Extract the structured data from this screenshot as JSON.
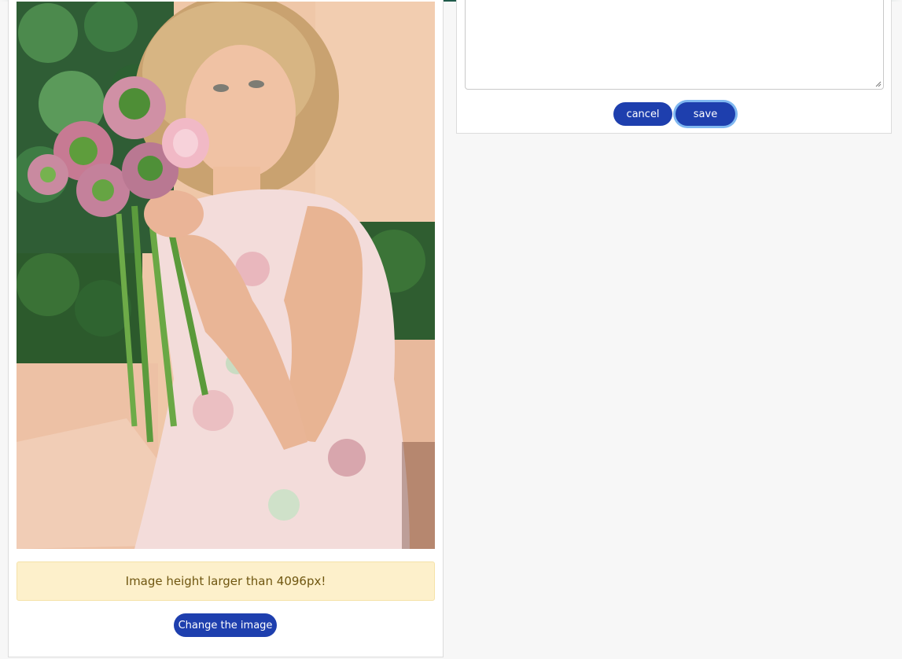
{
  "editor": {
    "alert_text": "Image height larger than 4096px!",
    "change_image_label": "Change the image",
    "cancel_label": "cancel",
    "save_label": "save"
  },
  "colors": {
    "primary_button": "#1e3fae",
    "focus_ring": "#7fb7f0",
    "alert_background": "#fdf0cb",
    "alert_text": "#6f5610",
    "page_background": "#f7f7f7"
  }
}
